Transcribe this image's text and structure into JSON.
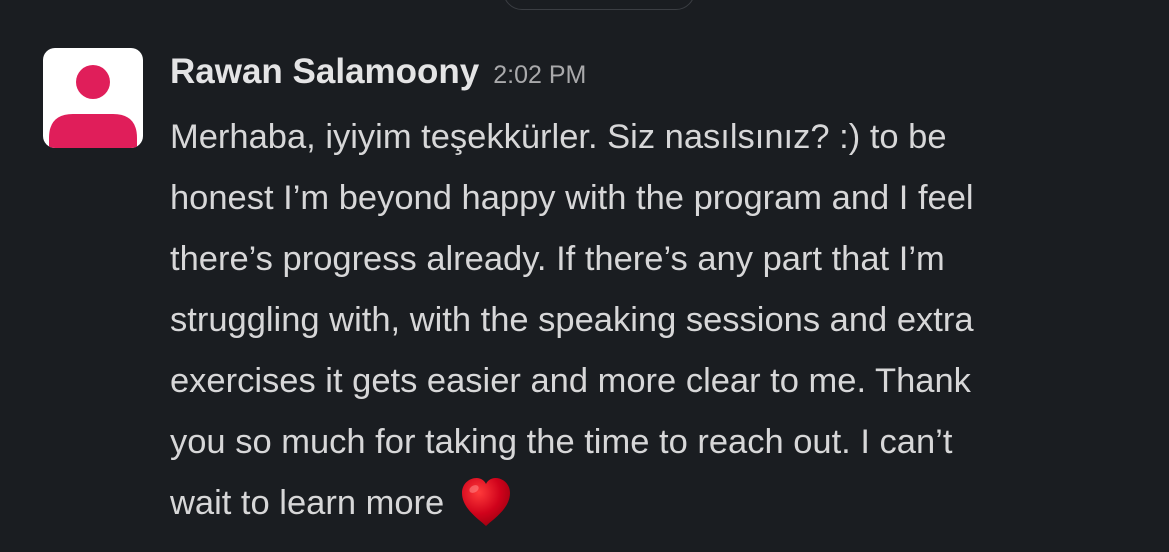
{
  "message": {
    "sender": "Rawan Salamoony",
    "timestamp": "2:02 PM",
    "lines": [
      "Merhaba, iyiyim teşekkürler. Siz nasılsınız? :) to be",
      "honest I’m beyond happy with the program and I feel",
      "there’s progress already. If there’s any part that I’m",
      "struggling with, with the speaking sessions and extra",
      "exercises it gets easier and more clear to me. Thank",
      "you so much for taking the time to reach out. I can’t",
      "wait to learn more"
    ],
    "emoji": "heart-icon"
  },
  "colors": {
    "background": "#1a1d21",
    "avatar_bg": "#ffffff",
    "avatar_accent": "#e01e5a",
    "heart": "#d0021b"
  }
}
